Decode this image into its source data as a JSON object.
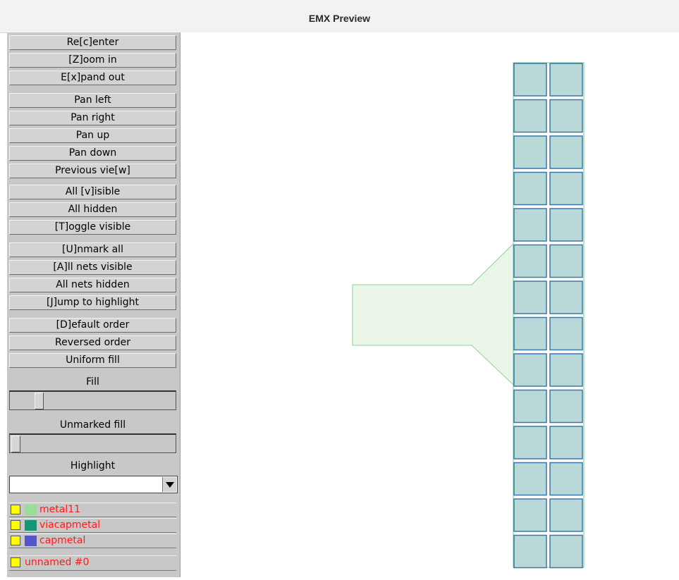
{
  "window": {
    "title": "EMX Preview"
  },
  "buttons": {
    "recenter": "Re[c]enter",
    "zoom_in": "[Z]oom in",
    "expand_out": "E[x]pand out",
    "pan_left": "Pan left",
    "pan_right": "Pan right",
    "pan_up": "Pan up",
    "pan_down": "Pan down",
    "previous_view": "Previous vie[w]",
    "all_visible": "All [v]isible",
    "all_hidden": "All hidden",
    "toggle_visible": "[T]oggle visible",
    "unmark_all": "[U]nmark all",
    "all_nets_visible": "[A]ll nets visible",
    "all_nets_hidden": "All nets hidden",
    "jump_to_highlight": "[J]ump to highlight",
    "default_order": "[D]efault order",
    "reversed_order": "Reversed order",
    "uniform_fill": "Uniform fill"
  },
  "sliders": {
    "fill_label": "Fill",
    "fill_value": 0.15,
    "unmarked_fill_label": "Unmarked fill",
    "unmarked_fill_value": 0.0
  },
  "highlight": {
    "label": "Highlight",
    "value": ""
  },
  "layers": [
    {
      "name": "metal11",
      "color": "#99dd99",
      "visible_color": "#ffff00"
    },
    {
      "name": "viacapmetal",
      "color": "#119977",
      "visible_color": "#ffff00"
    },
    {
      "name": "capmetal",
      "color": "#5555cc",
      "visible_color": "#ffff00"
    }
  ],
  "nets": [
    {
      "name": "unnamed #0",
      "visible_color": "#ffff00"
    }
  ],
  "canvas": {
    "cell_fill": "#b8d9d7",
    "cell_border": "#3b78a8",
    "strip_border": "#6cc98a",
    "shape_fill": "#eaf7e8",
    "shape_border": "#8fd09a"
  }
}
